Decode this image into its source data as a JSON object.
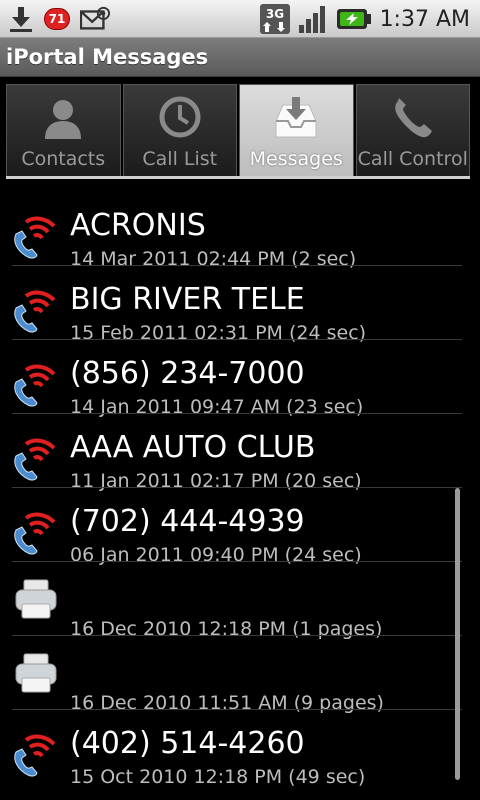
{
  "status_bar": {
    "notification_count": "71",
    "network": "3G",
    "time": "1:37 AM"
  },
  "title": "iPortal Messages",
  "tabs": [
    {
      "label": "Contacts",
      "icon": "person-icon",
      "selected": false
    },
    {
      "label": "Call List",
      "icon": "clock-icon",
      "selected": false
    },
    {
      "label": "Messages",
      "icon": "inbox-icon",
      "selected": true
    },
    {
      "label": "Call Control",
      "icon": "phone-icon",
      "selected": false
    }
  ],
  "messages": [
    {
      "name": "ACRONIS",
      "detail": "14 Mar 2011 02:44 PM (2 sec)",
      "type": "voicemail"
    },
    {
      "name": "BIG RIVER TELE",
      "detail": "15 Feb 2011 02:31 PM (24 sec)",
      "type": "voicemail"
    },
    {
      "name": "(856) 234-7000",
      "detail": "14 Jan 2011 09:47 AM (23 sec)",
      "type": "voicemail"
    },
    {
      "name": "AAA AUTO CLUB",
      "detail": "11 Jan 2011 02:17 PM (20 sec)",
      "type": "voicemail"
    },
    {
      "name": "(702) 444-4939",
      "detail": "06 Jan 2011 09:40 PM (24 sec)",
      "type": "voicemail"
    },
    {
      "name": "",
      "detail": "16 Dec 2010 12:18 PM (1 pages)",
      "type": "fax"
    },
    {
      "name": "",
      "detail": "16 Dec 2010 11:51 AM (9 pages)",
      "type": "fax"
    },
    {
      "name": "(402) 514-4260",
      "detail": "15 Oct 2010 12:18 PM (49 sec)",
      "type": "voicemail"
    }
  ],
  "colors": {
    "voicemail_wave": "#e02020",
    "phone_blue": "#4a8ccf"
  }
}
